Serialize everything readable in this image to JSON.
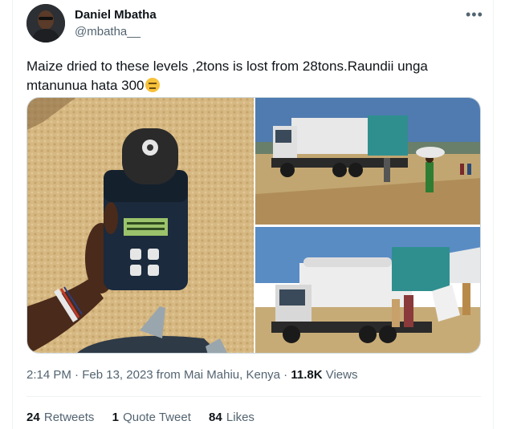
{
  "author": {
    "name": "Daniel Mbatha",
    "handle": "@mbatha__"
  },
  "tweet": {
    "text": "Maize dried to these levels ,2tons is lost from 28tons.Raundii unga mtanunua hata 300",
    "emoji": "expressionless-face",
    "media_count": 3
  },
  "meta": {
    "time": "2:14 PM",
    "separator1": " · ",
    "date": "Feb 13, 2023 from Mai Mahiu, Kenya",
    "separator2": " · ",
    "views_count": "11.8K",
    "views_label": " Views"
  },
  "stats": {
    "retweets_count": "24",
    "retweets_label": "Retweets",
    "quotes_count": "1",
    "quotes_label": "Quote Tweet",
    "likes_count": "84",
    "likes_label": "Likes"
  },
  "icons": {
    "more": "more-horizontal-icon"
  },
  "colors": {
    "text_primary": "#0f1419",
    "text_secondary": "#536471",
    "border": "#eff3f4"
  }
}
